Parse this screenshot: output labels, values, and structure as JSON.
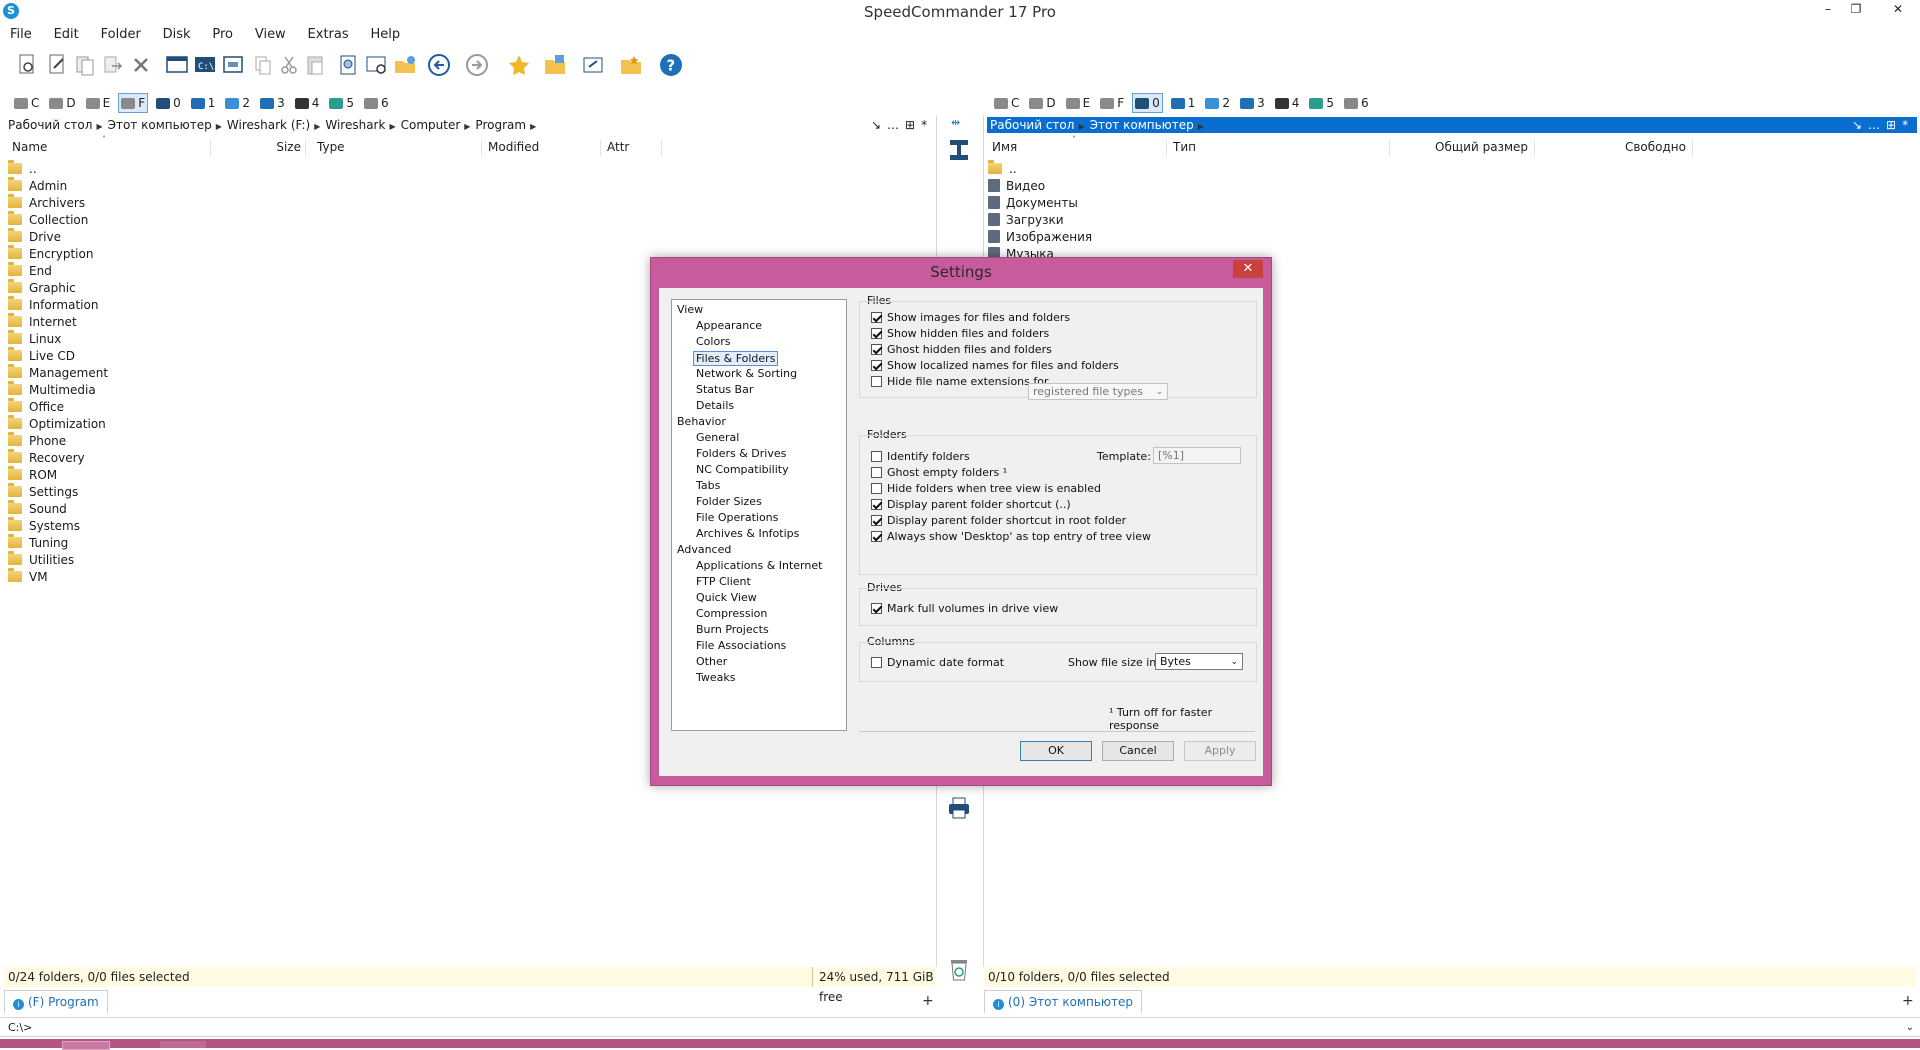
{
  "window": {
    "title": "SpeedCommander 17 Pro",
    "minimize": "–",
    "restore": "❐",
    "close": "✕"
  },
  "menu": [
    "File",
    "Edit",
    "Folder",
    "Disk",
    "Pro",
    "View",
    "Extras",
    "Help"
  ],
  "left": {
    "drives": [
      {
        "letter": "C",
        "icon": "hdd-icon"
      },
      {
        "letter": "D",
        "icon": "hdd-icon"
      },
      {
        "letter": "E",
        "icon": "hdd-icon"
      },
      {
        "letter": "F",
        "icon": "hdd-icon",
        "selected": true
      },
      {
        "letter": "0",
        "icon": "monitor-icon"
      },
      {
        "letter": "1",
        "icon": "network-icon"
      },
      {
        "letter": "2",
        "icon": "ftp-icon"
      },
      {
        "letter": "3",
        "icon": "network-icon"
      },
      {
        "letter": "4",
        "icon": "archive-icon"
      },
      {
        "letter": "5",
        "icon": "book-icon"
      },
      {
        "letter": "6",
        "icon": "globe-icon"
      }
    ],
    "breadcrumb": [
      "Рабочий стол",
      "Этот компьютер",
      "Wireshark (F:)",
      "Wireshark",
      "Computer",
      "Program"
    ],
    "columns": [
      "Name",
      "Size",
      "Type",
      "Modified",
      "Attr"
    ],
    "files": [
      "..",
      "Admin",
      "Archivers",
      "Collection",
      "Drive",
      "Encryption",
      "End",
      "Graphic",
      "Information",
      "Internet",
      "Linux",
      "Live CD",
      "Management",
      "Multimedia",
      "Office",
      "Optimization",
      "Phone",
      "Recovery",
      "ROM",
      "Settings",
      "Sound",
      "Systems",
      "Tuning",
      "Utilities",
      "VM"
    ],
    "status": "0/24 folders, 0/0 files selected",
    "free": "24% used, 711 GiB free",
    "tab": "(F) Program"
  },
  "right": {
    "drives": [
      {
        "letter": "C",
        "icon": "hdd-icon"
      },
      {
        "letter": "D",
        "icon": "hdd-icon"
      },
      {
        "letter": "E",
        "icon": "hdd-icon"
      },
      {
        "letter": "F",
        "icon": "hdd-icon"
      },
      {
        "letter": "0",
        "icon": "monitor-icon",
        "selected": true
      },
      {
        "letter": "1",
        "icon": "network-icon"
      },
      {
        "letter": "2",
        "icon": "ftp-icon"
      },
      {
        "letter": "3",
        "icon": "network-icon"
      },
      {
        "letter": "4",
        "icon": "archive-icon"
      },
      {
        "letter": "5",
        "icon": "book-icon"
      },
      {
        "letter": "6",
        "icon": "globe-icon"
      }
    ],
    "breadcrumb": [
      "Рабочий стол",
      "Этот компьютер"
    ],
    "columns": [
      "Имя",
      "Тип",
      "Общий размер",
      "Свободно"
    ],
    "files": [
      "..",
      "Видео",
      "Документы",
      "Загрузки",
      "Изображения",
      "Музыка"
    ],
    "status": "0/10 folders, 0/0 files selected",
    "tab": "(0) Этот компьютер"
  },
  "cmdline": "C:\\>",
  "dialog": {
    "title": "Settings",
    "close": "✕",
    "tree": [
      {
        "label": "View",
        "level": 0
      },
      {
        "label": "Appearance",
        "level": 1
      },
      {
        "label": "Colors",
        "level": 1
      },
      {
        "label": "Files & Folders",
        "level": 1,
        "selected": true
      },
      {
        "label": "Network & Sorting",
        "level": 1
      },
      {
        "label": "Status Bar",
        "level": 1
      },
      {
        "label": "Details",
        "level": 1
      },
      {
        "label": "Behavior",
        "level": 0
      },
      {
        "label": "General",
        "level": 1
      },
      {
        "label": "Folders & Drives",
        "level": 1
      },
      {
        "label": "NC Compatibility",
        "level": 1
      },
      {
        "label": "Tabs",
        "level": 1
      },
      {
        "label": "Folder Sizes",
        "level": 1
      },
      {
        "label": "File Operations",
        "level": 1
      },
      {
        "label": "Archives & Infotips",
        "level": 1
      },
      {
        "label": "Advanced",
        "level": 0
      },
      {
        "label": "Applications & Internet",
        "level": 1
      },
      {
        "label": "FTP Client",
        "level": 1
      },
      {
        "label": "Quick View",
        "level": 1
      },
      {
        "label": "Compression",
        "level": 1
      },
      {
        "label": "Burn Projects",
        "level": 1
      },
      {
        "label": "File Associations",
        "level": 1
      },
      {
        "label": "Other",
        "level": 1
      },
      {
        "label": "Tweaks",
        "level": 1
      }
    ],
    "files_group": {
      "label": "Files",
      "options": [
        {
          "label": "Show images for files and folders",
          "checked": true
        },
        {
          "label": "Show hidden files and folders",
          "checked": true
        },
        {
          "label": "Ghost hidden files and folders",
          "checked": true
        },
        {
          "label": "Show localized names for files and folders",
          "checked": true
        },
        {
          "label": "Hide file name extensions for",
          "checked": false
        }
      ],
      "ext_select": "registered file types"
    },
    "folders_group": {
      "label": "Folders",
      "template_label": "Template:",
      "template_value": "[%1]",
      "options": [
        {
          "label": "Identify folders",
          "checked": false
        },
        {
          "label": "Ghost empty folders ¹",
          "checked": false
        },
        {
          "label": "Hide folders when tree view is enabled",
          "checked": false
        },
        {
          "label": "Display parent folder shortcut (..)",
          "checked": true
        },
        {
          "label": "Display parent folder shortcut in root folder",
          "checked": true
        },
        {
          "label": "Always show 'Desktop' as top entry of tree view",
          "checked": true
        }
      ]
    },
    "drives_group": {
      "label": "Drives",
      "options": [
        {
          "label": "Mark full volumes in drive view",
          "checked": true
        }
      ]
    },
    "columns_group": {
      "label": "Columns",
      "options": [
        {
          "label": "Dynamic date format",
          "checked": false
        }
      ],
      "size_label": "Show file size in:",
      "size_value": "Bytes"
    },
    "footnote": "¹ Turn off for faster response",
    "buttons": {
      "ok": "OK",
      "cancel": "Cancel",
      "apply": "Apply"
    }
  }
}
